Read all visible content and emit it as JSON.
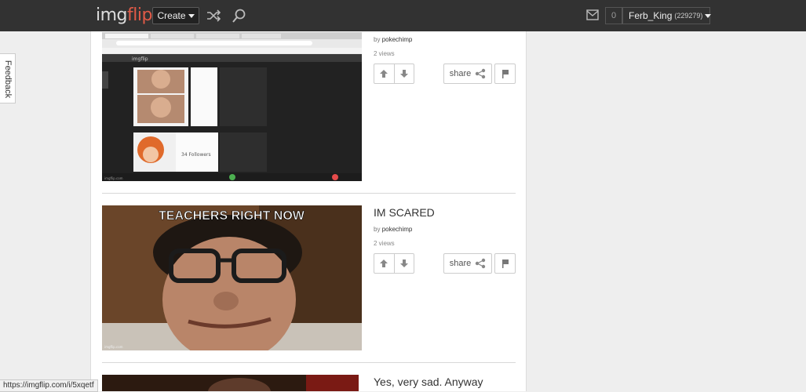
{
  "header": {
    "logo_img": "img",
    "logo_flip": "flip",
    "create_label": "Create",
    "notification_count": "0",
    "username": "Ferb_King",
    "user_points": "(229279)"
  },
  "feedback_label": "Feedback",
  "posts": [
    {
      "title": "",
      "by_prefix": "by",
      "author": "pokechimp",
      "views": "2 views",
      "share_label": "share",
      "thumb_texts": {
        "watermark": "imgflip.com",
        "followers": "34 Followers"
      }
    },
    {
      "title": "IM SCARED",
      "by_prefix": "by",
      "author": "pokechimp",
      "views": "2 views",
      "share_label": "share",
      "thumb_texts": {
        "caption": "TEACHERS RIGHT NOW",
        "watermark": "imgflip.com"
      }
    },
    {
      "title": "Yes, very sad. Anyway"
    }
  ],
  "status_url": "https://imgflip.com/i/5xqetf",
  "status_overlay": "imgflip.com",
  "colors": {
    "header_bg": "#323232",
    "logo_accent": "#e05a47"
  }
}
